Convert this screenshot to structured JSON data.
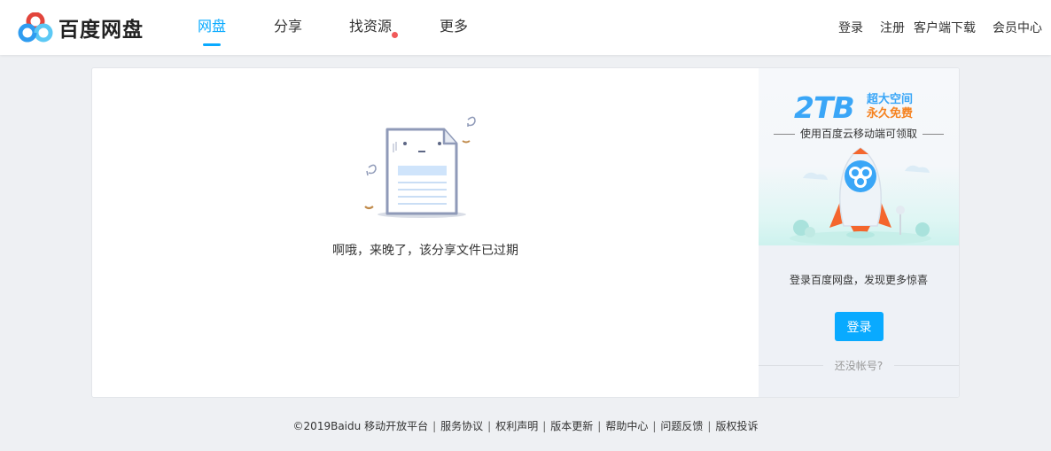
{
  "header": {
    "logo_text": "百度网盘",
    "nav": [
      {
        "label": "网盘",
        "active": true
      },
      {
        "label": "分享",
        "active": false
      },
      {
        "label": "找资源",
        "active": false,
        "badge_dot": true
      },
      {
        "label": "更多",
        "active": false
      }
    ],
    "right_links": [
      "登录",
      "注册",
      "客户端下载",
      "会员中心"
    ]
  },
  "main": {
    "message": "啊哦，来晚了，该分享文件已过期"
  },
  "promo": {
    "headline_big": "2TB",
    "headline_tag_line1": "超大空间",
    "headline_tag_line2": "永久免费",
    "subtitle": "使用百度云移动端可领取",
    "message": "登录百度网盘，发现更多惊喜",
    "login_button": "登录",
    "no_account": "还没帐号?"
  },
  "footer": {
    "copyright": "©2019Baidu",
    "links": [
      "移动开放平台",
      "服务协议",
      "权利声明",
      "版本更新",
      "帮助中心",
      "问题反馈",
      "版权投诉"
    ]
  },
  "colors": {
    "accent": "#09aaff",
    "badge": "#f15a5a",
    "promo_blue": "#3aa6f7",
    "promo_orange": "#f5821f"
  },
  "icons": {
    "logo": "baidu-netdisk-logo-icon",
    "illustration": "expired-document-icon",
    "rocket": "rocket-illustration-icon"
  }
}
